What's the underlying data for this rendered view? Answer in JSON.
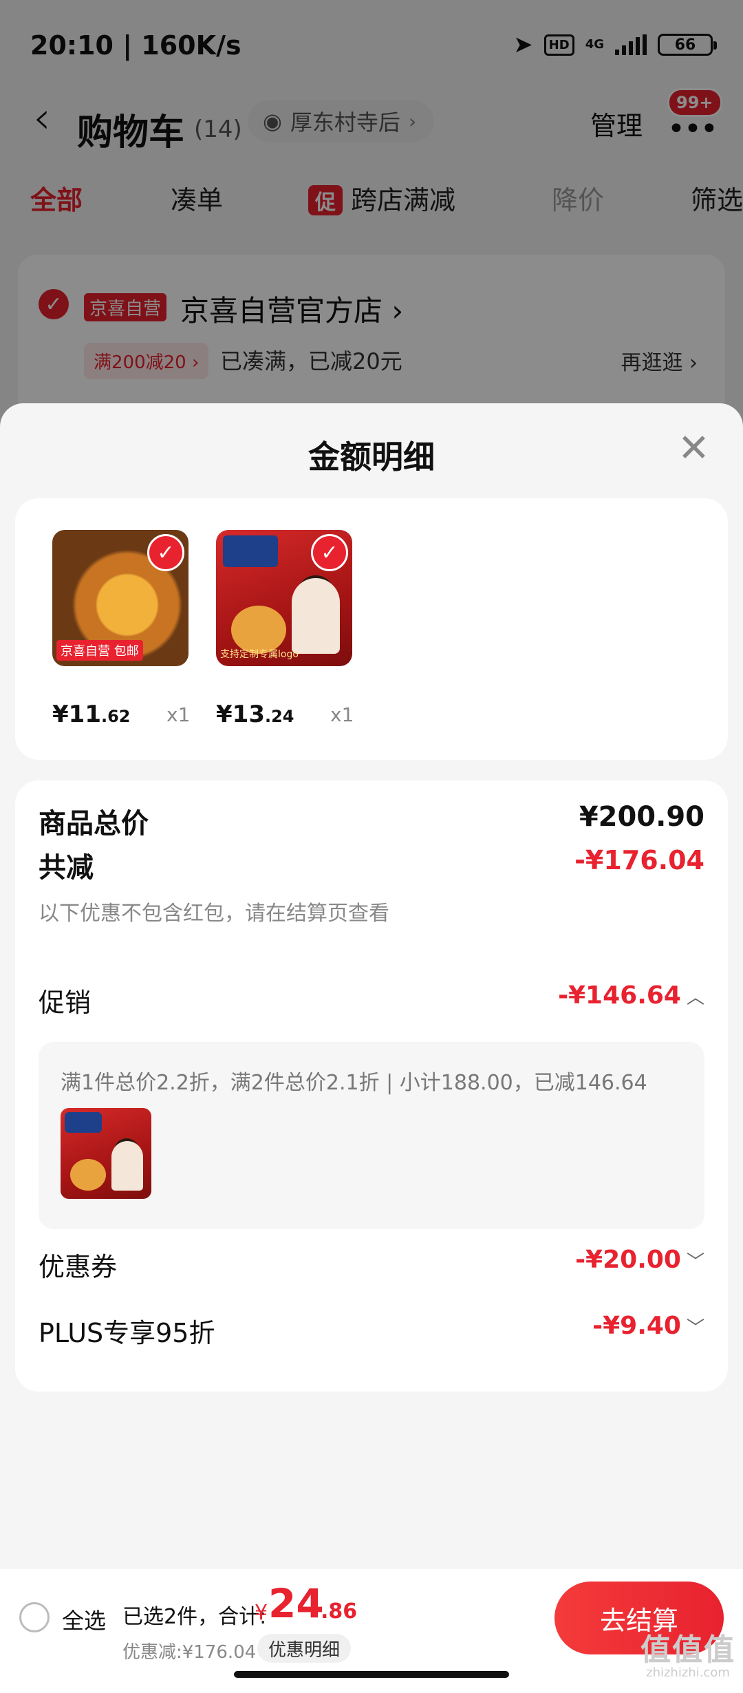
{
  "status_bar": {
    "time": "20:10 | 160K/s",
    "network": "4G",
    "hd": "HD",
    "battery": "66"
  },
  "nav": {
    "title": "购物车",
    "count": "(14)",
    "location": "厚东村寺后",
    "manage": "管理",
    "badge": "99+"
  },
  "tabs": [
    {
      "label": "全部"
    },
    {
      "label": "凑单"
    },
    {
      "label": "跨店满减",
      "tag": "促"
    },
    {
      "label": "降价"
    },
    {
      "label": "筛选"
    }
  ],
  "store": {
    "tag": "京喜自营",
    "name": "京喜自营官方店",
    "promo_tag": "满200减20 ›",
    "promo_text": "已凑满，已减20元",
    "stroll": "再逛逛 ›"
  },
  "sheet": {
    "title": "金额明细",
    "goods": [
      {
        "price_int": "¥11",
        "price_dec": ".62",
        "qty": "x1",
        "thumb_tag": "京喜自营 包邮"
      },
      {
        "price_int": "¥13",
        "price_dec": ".24",
        "qty": "x1",
        "thumb_tag": "支持定制专属logo"
      }
    ],
    "total_label": "商品总价",
    "total_value": "¥200.90",
    "reduce_label": "共减",
    "reduce_value": "-¥176.04",
    "hint": "以下优惠不包含红包，请在结算页查看",
    "promo_label": "促销",
    "promo_value": "-¥146.64",
    "promo_detail": "满1件总价2.2折，满2件总价2.1折 | 小计188.00，已减146.64",
    "coupon_label": "优惠券",
    "coupon_value": "-¥20.00",
    "plus_label": "PLUS专享95折",
    "plus_value": "-¥9.40"
  },
  "bottom": {
    "select_all": "全选",
    "selected": "已选2件，合计:",
    "total_symbol": "¥",
    "total_int": "24",
    "total_dec": ".86",
    "discount": "优惠减:¥176.04",
    "detail_button": "优惠明细",
    "checkout": "去结算"
  },
  "watermark": {
    "big": "值值值",
    "small": "zhizhizhi.com"
  }
}
